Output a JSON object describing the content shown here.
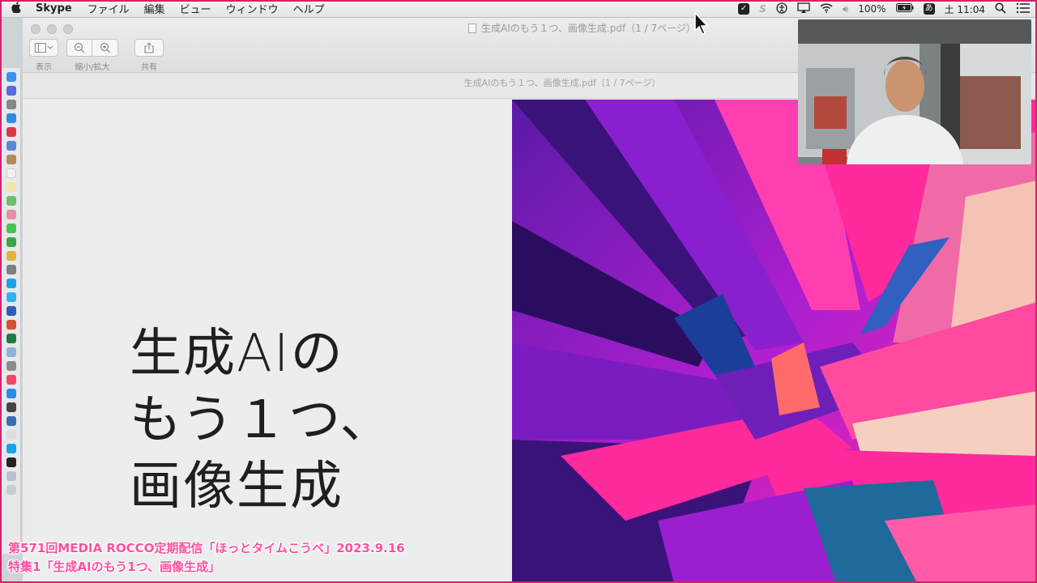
{
  "menubar": {
    "apple": "",
    "app_name": "Skype",
    "items": [
      "ファイル",
      "編集",
      "ビュー",
      "ウィンドウ",
      "ヘルプ"
    ],
    "battery": "100%",
    "input_method": "あ",
    "clock": "土 11:04"
  },
  "window": {
    "title": "生成AIのもう１つ、画像生成.pdf（1 / 7ページ）",
    "subtitle": "生成AIのもう１つ、画像生成.pdf（1 / 7ページ）",
    "toolbar": {
      "view_label": "表示",
      "zoom_label": "縮小/拡大",
      "share_label": "共有"
    }
  },
  "slide": {
    "title": "生成AIの\nもう１つ、\n画像生成"
  },
  "caption": {
    "line1": "第571回MEDIA ROCCO定期配信「ほっとタイムこうべ」2023.9.16",
    "line2": "特集1「生成AIのもう1つ、画像生成」"
  },
  "colors": {
    "caption": "#ff4fa0",
    "frame": "#d1236a",
    "art_pink": "#ff2a9c",
    "art_purple": "#8a1fd0"
  }
}
